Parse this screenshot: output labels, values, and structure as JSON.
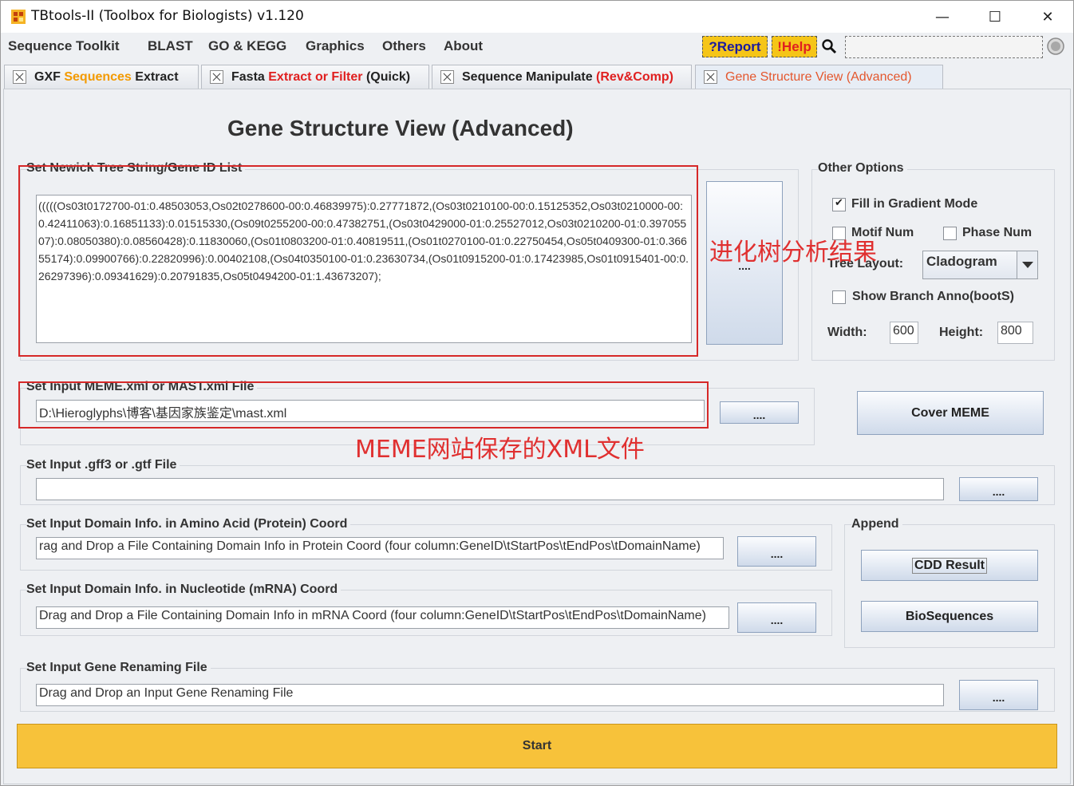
{
  "window": {
    "title": "TBtools-II (Toolbox for Biologists) v1.120",
    "minimize": "—",
    "maximize": "☐",
    "close": "✕"
  },
  "menu": [
    "Sequence Toolkit",
    "BLAST",
    "GO & KEGG",
    "Graphics",
    "Others",
    "About"
  ],
  "toolbar": {
    "report": "?Report",
    "help": "!Help",
    "search_placeholder": ""
  },
  "tabs": [
    {
      "p1": "GXF ",
      "p2": "Sequences",
      "p3": " Extract"
    },
    {
      "p1": "Fasta ",
      "p2": "Extract or Filter",
      "p3": " (Quick)"
    },
    {
      "p1": "Sequence Manipulate ",
      "p2": "(Rev&Comp)",
      "p3": ""
    },
    {
      "p1": "Gene Structure View (Advanced)"
    }
  ],
  "heading": "Gene Structure View (Advanced)",
  "newick": {
    "legend": "Set Newick Tree String/Gene ID List",
    "value": "(((((Os03t0172700-01:0.48503053,Os02t0278600-00:0.46839975):0.27771872,(Os03t0210100-00:0.15125352,Os03t0210000-00:0.42411063):0.16851133):0.01515330,(Os09t0255200-00:0.47382751,(Os03t0429000-01:0.25527012,Os03t0210200-01:0.39705507):0.08050380):0.08560428):0.11830060,(Os01t0803200-01:0.40819511,(Os01t0270100-01:0.22750454,Os05t0409300-01:0.36655174):0.09900766):0.22820996):0.00402108,(Os04t0350100-01:0.23630734,(Os01t0915200-01:0.17423985,Os01t0915401-00:0.26297396):0.09341629):0.20791835,Os05t0494200-01:1.43673207);",
    "button": "...."
  },
  "options": {
    "legend": "Other Options",
    "fill_gradient": "Fill in Gradient Mode",
    "motif_num": "Motif Num",
    "phase_num": "Phase Num",
    "tree_layout_label": "Tree Layout:",
    "tree_layout_value": "Cladogram",
    "show_branch": "Show Branch Anno(bootS)",
    "width_label": "Width:",
    "width_value": "600",
    "height_label": "Height:",
    "height_value": "800"
  },
  "meme": {
    "legend": "Set Input MEME.xml or MAST.xml File",
    "value": "D:\\Hieroglyphs\\博客\\基因家族鉴定\\mast.xml",
    "button": "....",
    "cover": "Cover MEME"
  },
  "gff": {
    "legend": "Set Input .gff3 or .gtf File",
    "value": "",
    "button": "...."
  },
  "domain_protein": {
    "legend": "Set Input Domain Info. in Amino Acid (Protein) Coord",
    "value": "rag and Drop a File Containing Domain Info in Protein Coord (four column:GeneID\\tStartPos\\tEndPos\\tDomainName)",
    "button": "...."
  },
  "domain_mrna": {
    "legend": "Set Input Domain Info. in Nucleotide (mRNA) Coord",
    "value": "Drag and Drop a File Containing Domain Info in mRNA Coord (four column:GeneID\\tStartPos\\tEndPos\\tDomainName)",
    "button": "...."
  },
  "append": {
    "legend": "Append",
    "cdd": "CDD Result",
    "bioseq": "BioSequences"
  },
  "renaming": {
    "legend": "Set Input Gene Renaming File",
    "value": "Drag and Drop an Input Gene Renaming File",
    "button": "...."
  },
  "start": "Start",
  "annotations": {
    "tree": "进化树分析结果",
    "meme": "MEME网站保存的XML文件"
  }
}
